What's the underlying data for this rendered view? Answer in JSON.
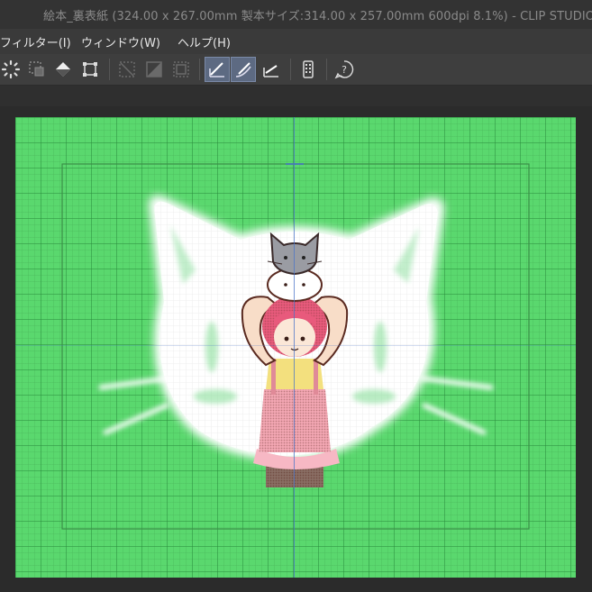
{
  "window": {
    "title": "絵本_裏表紙 (324.00 x 267.00mm 製本サイズ:314.00 x 257.00mm 600dpi 8.1%)  - CLIP STUDIO"
  },
  "menu": {
    "items": [
      {
        "label": "フィルター(I)"
      },
      {
        "label": "ウィンドウ(W)"
      },
      {
        "label": "ヘルプ(H)"
      }
    ]
  },
  "toolbar": {
    "buttons": [
      {
        "icon": "lasso-select-icon",
        "active": false
      },
      {
        "icon": "select-layer-icon",
        "active": false
      },
      {
        "icon": "fill-icon",
        "active": false
      },
      {
        "icon": "transform-icon",
        "active": false
      },
      {
        "icon": "clear-outside-icon",
        "active": false
      },
      {
        "icon": "clear-inside-icon",
        "active": false
      },
      {
        "icon": "ruler-frame-icon",
        "active": false
      },
      {
        "icon": "snap-to-ruler-icon",
        "active": true
      },
      {
        "icon": "snap-to-special-ruler-icon",
        "active": true
      },
      {
        "icon": "snap-to-grid-icon",
        "active": false
      },
      {
        "icon": "tablet-icon",
        "active": false
      },
      {
        "icon": "help-icon",
        "active": false
      }
    ]
  },
  "colors": {
    "canvas_bg": "#5ad86e",
    "guide": "#4a74c8",
    "toolbar_active": "#5d6a82"
  }
}
